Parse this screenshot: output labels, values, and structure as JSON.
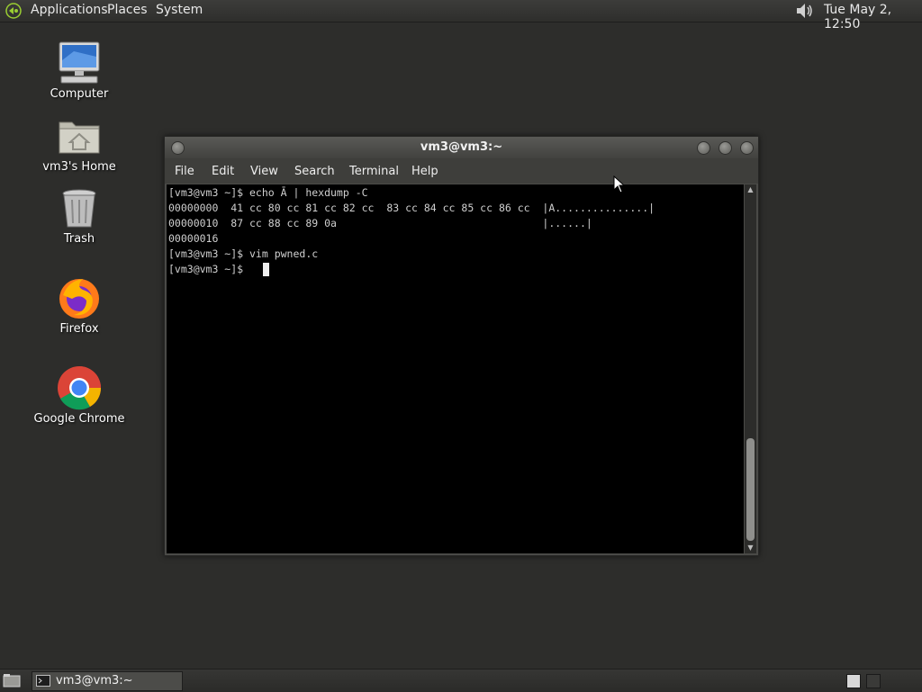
{
  "top_panel": {
    "menus": [
      "Applications",
      "Places",
      "System"
    ],
    "clock": "Tue May  2, 12:50",
    "logo_icon": "gnome-foot-icon",
    "volume_icon": "speaker-icon"
  },
  "desktop": {
    "icons": [
      {
        "label": "Computer",
        "icon": "computer-icon"
      },
      {
        "label": "vm3's Home",
        "icon": "home-folder-icon"
      },
      {
        "label": "Trash",
        "icon": "trash-icon"
      },
      {
        "label": "Firefox",
        "icon": "firefox-icon"
      },
      {
        "label": "Google Chrome",
        "icon": "chrome-icon"
      }
    ]
  },
  "terminal_window": {
    "title": "vm3@vm3:~",
    "menu": [
      "File",
      "Edit",
      "View",
      "Search",
      "Terminal",
      "Help"
    ],
    "lines": [
      "[vm3@vm3 ~]$ echo Ā | hexdump -C",
      "00000000  41 cc 80 cc 81 cc 82 cc  83 cc 84 cc 85 cc 86 cc  |A...............|",
      "00000010  87 cc 88 cc 89 0a                                 |......|",
      "00000016",
      "[vm3@vm3 ~]$ vim pwned.c",
      "[vm3@vm3 ~]$ "
    ]
  },
  "bottom_panel": {
    "task_label": "vm3@vm3:~",
    "show_desktop_icon": "show-desktop-icon",
    "terminal_icon": "terminal-icon"
  },
  "colors": {
    "desktop_bg": "#2d2d2b",
    "terminal_bg": "#000000",
    "terminal_fg": "#cfcfcf"
  }
}
